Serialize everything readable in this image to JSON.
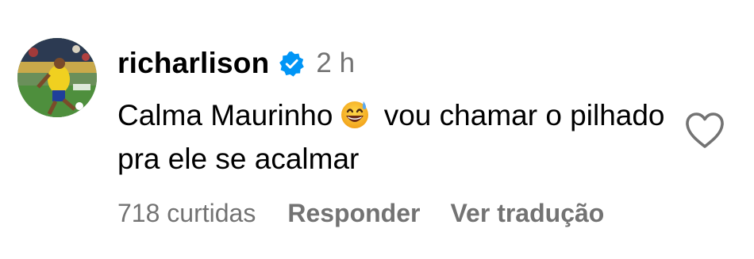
{
  "comment": {
    "username": "richarlison",
    "verified_icon": "verified-badge-icon",
    "timestamp": "2 h",
    "text_before_emoji": "Calma Maurinho",
    "emoji_icon": "grinning-sweat-emoji",
    "text_after_emoji": "vou chamar o pilhado pra ele se acalmar",
    "likes": "718 curtidas",
    "reply_label": "Responder",
    "translate_label": "Ver tradução",
    "like_icon": "heart-outline-icon"
  },
  "colors": {
    "text": "#000000",
    "muted": "#737373",
    "verified_blue": "#0095f6"
  }
}
